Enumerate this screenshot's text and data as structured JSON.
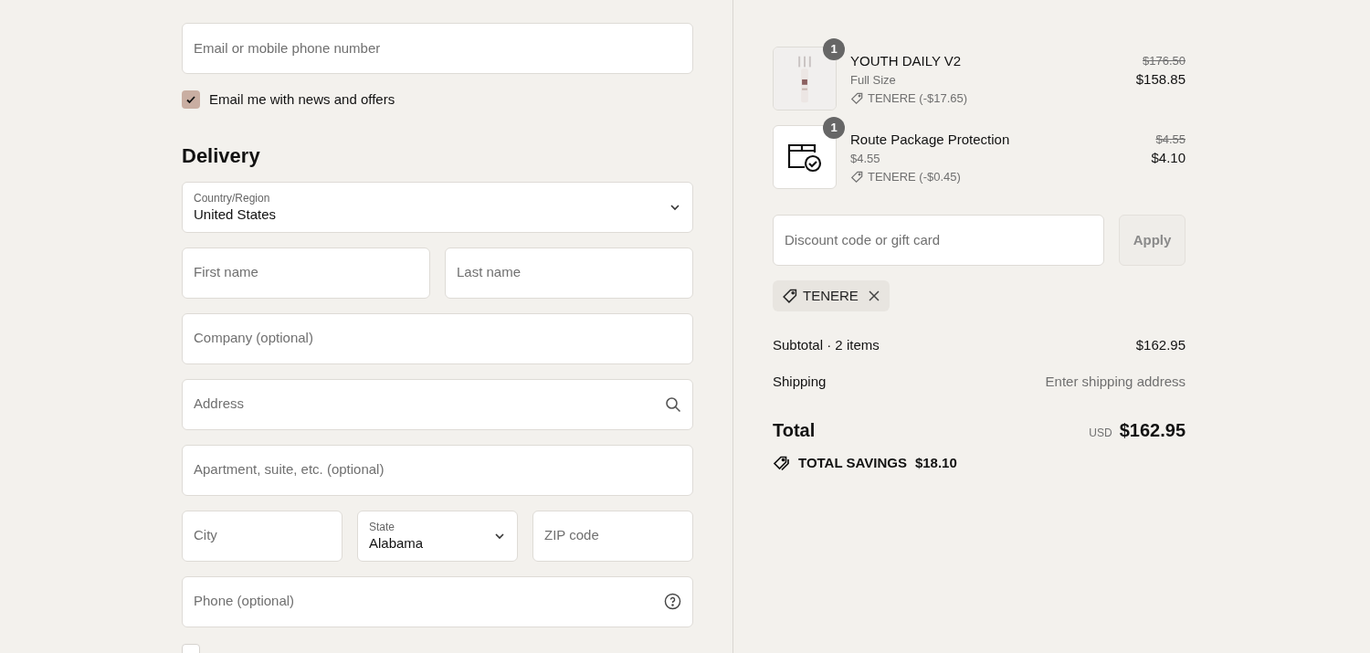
{
  "contact": {
    "email": {
      "placeholder": "Email or mobile phone number"
    },
    "news_checkbox": {
      "label": "Email me with news and offers",
      "checked": true
    }
  },
  "delivery": {
    "heading": "Delivery",
    "rows": [
      [
        {
          "kind": "select",
          "label": "Country/Region",
          "value": "United States"
        }
      ],
      [
        {
          "kind": "input",
          "placeholder": "First name"
        },
        {
          "kind": "input",
          "placeholder": "Last name"
        }
      ],
      [
        {
          "kind": "input",
          "placeholder": "Company (optional)"
        }
      ],
      [
        {
          "kind": "search",
          "placeholder": "Address"
        }
      ],
      [
        {
          "kind": "input",
          "placeholder": "Apartment, suite, etc. (optional)"
        }
      ],
      [
        {
          "kind": "input",
          "placeholder": "City"
        },
        {
          "kind": "select",
          "label": "State",
          "value": "Alabama"
        },
        {
          "kind": "input",
          "placeholder": "ZIP code"
        }
      ],
      [
        {
          "kind": "help",
          "placeholder": "Phone (optional)"
        }
      ]
    ],
    "sms_checkbox": {
      "checked": false
    }
  },
  "order": {
    "items": [
      {
        "kind": "product",
        "quantity": "1",
        "name": "YOUTH DAILY V2",
        "variant": "Full Size",
        "discount": "TENERE (-$17.65)",
        "original_price": "$176.50",
        "price": "$158.85"
      },
      {
        "kind": "route",
        "quantity": "1",
        "name": "Route Package Protection",
        "variant": "$4.55",
        "discount": "TENERE (-$0.45)",
        "original_price": "$4.55",
        "price": "$4.10"
      }
    ],
    "discount_field": {
      "placeholder": "Discount code or gift card"
    },
    "apply_button": {
      "label": "Apply",
      "disabled": true
    },
    "applied_codes": [
      {
        "code": "TENERE"
      }
    ],
    "summary": {
      "subtotal_label": "Subtotal · 2 items",
      "subtotal_value": "$162.95",
      "shipping_label": "Shipping",
      "shipping_value": "Enter shipping address",
      "total_label": "Total",
      "currency": "USD",
      "total_value": "$162.95",
      "savings_label": "TOTAL SAVINGS",
      "savings_value": "$18.10"
    }
  }
}
